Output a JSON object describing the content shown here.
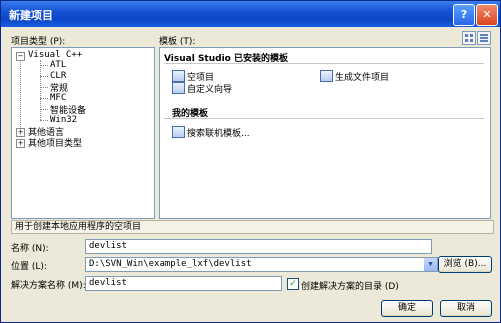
{
  "window": {
    "title": "新建项目"
  },
  "labels": {
    "project_types": "项目类型 (P):",
    "templates": "模板 (T):",
    "description": "用于创建本地应用程序的空项目",
    "name": "名称 (N):",
    "location": "位置 (L):",
    "solution_name": "解决方案名称 (M):",
    "create_dir": "创建解决方案的目录 (D)"
  },
  "tree": {
    "root": "Visual C++",
    "children": [
      "ATL",
      "CLR",
      "常规",
      "MFC",
      "智能设备",
      "Win32"
    ],
    "other_languages": "其他语言",
    "other_project_types": "其他项目类型"
  },
  "templates": {
    "installed_header": "Visual Studio 已安装的模板",
    "installed": [
      "空项目",
      "自定义向导"
    ],
    "installed_right": "生成文件项目",
    "my_header": "我的模板",
    "my": [
      "搜索联机模板..."
    ]
  },
  "fields": {
    "name": "devlist",
    "location": "D:\\SVN_Win\\example_lxf\\devlist",
    "solution_name": "devlist",
    "create_dir_checked": true
  },
  "buttons": {
    "browse": "浏览 (B)...",
    "ok": "确定",
    "cancel": "取消"
  },
  "icons": {
    "help": "?",
    "close": "✕",
    "check": "✓",
    "combo": "▼",
    "plus": "+",
    "minus": "−"
  }
}
